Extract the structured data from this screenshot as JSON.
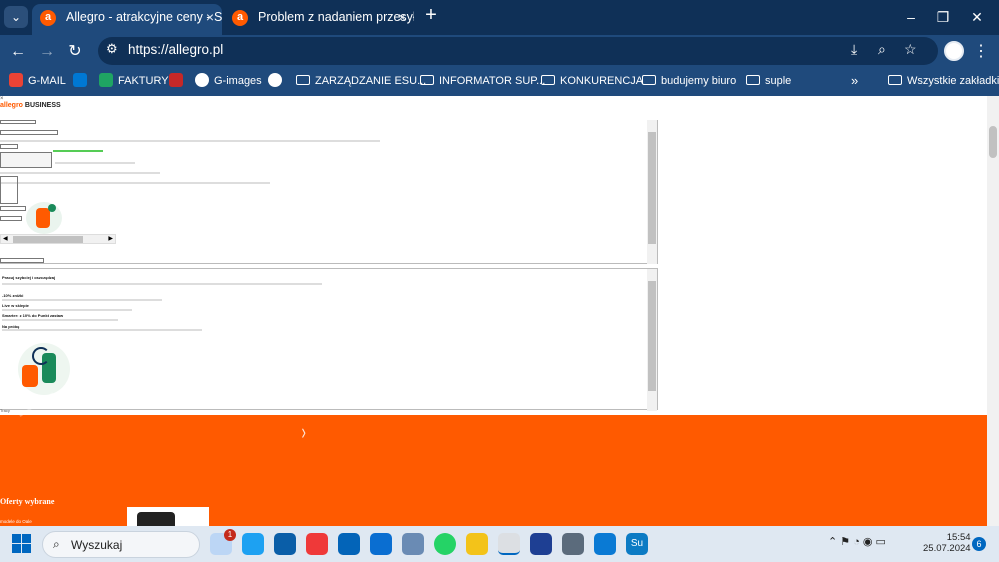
{
  "browser": {
    "tabs": [
      {
        "title": "Allegro - atrakcyjne ceny - Stron",
        "active": true,
        "favicon": "a"
      },
      {
        "title": "Problem z nadaniem przesyłki -",
        "active": false,
        "favicon": "a"
      }
    ],
    "url": "https://allegro.pl",
    "bookmarks": [
      "G-MAIL",
      "FAKTURY",
      "G-images",
      "ZARZĄDZANIE ESU...",
      "INFORMATOR SUP...",
      "KONKURENCJA",
      "budujemy biuro",
      "suple"
    ],
    "all_bookmarks": "Wszystkie zakładki",
    "overflow_icon": "double-chevron-right-icon"
  },
  "page": {
    "logo_allegro": "allegro",
    "logo_business": "BUSINESS",
    "offers_heading": "Oferty wybrane",
    "bottom_small": "modele do Oale",
    "section_label": "Tracy"
  },
  "frame2": {
    "heading": "Pracuj szybciej i oszczędzaj",
    "item1": "-10% zniżki",
    "item2": "Live w sklepie",
    "item3": "Smarter: z 10% do Punkt zastaw",
    "item4": "Na próbę"
  },
  "taskbar": {
    "search_placeholder": "Wyszukaj",
    "time": "15:54",
    "date": "25.07.2024",
    "notification_count": "6",
    "weather_badge": "1"
  },
  "colors": {
    "tabbar": "#0f3057",
    "toolbar": "#1f4a7c",
    "brand_orange": "#ff5a00",
    "taskbar": "#dfe8f2"
  }
}
